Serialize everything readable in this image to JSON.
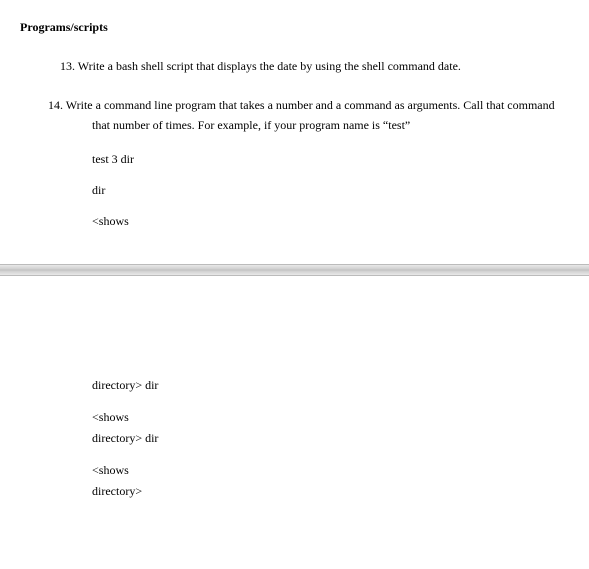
{
  "section_heading": "Programs/scripts",
  "q13": {
    "number": "13.",
    "text": "Write a bash shell script that displays the date by using the shell command date."
  },
  "q14": {
    "number": "14.",
    "text_line1": "Write a command line program that takes a number and a command as arguments. Call that command",
    "text_line2": "that number of times. For example, if your program name is “test”",
    "code1": "test 3 dir",
    "code2": "dir",
    "code3": "<shows",
    "code4a": "directory> dir",
    "code5a": "<shows",
    "code5b": "directory> dir",
    "code6a": "<shows",
    "code6b": "directory>"
  }
}
